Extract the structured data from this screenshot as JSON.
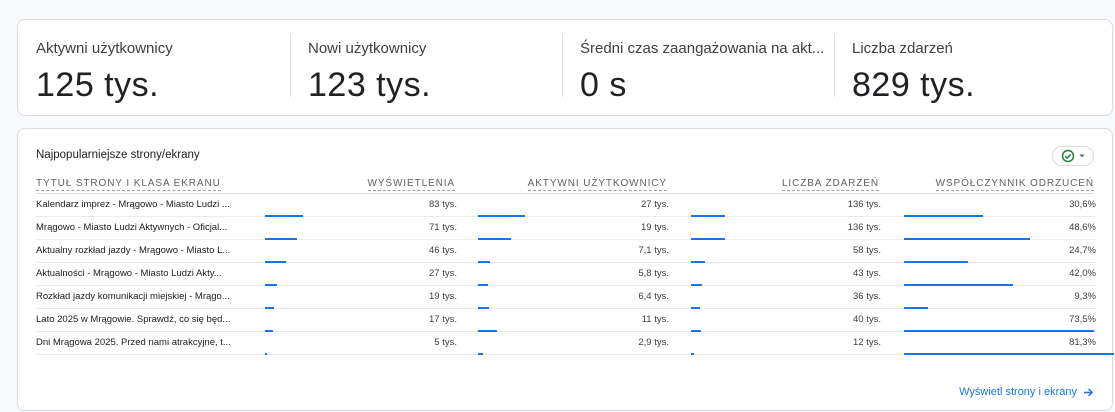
{
  "kpis": [
    {
      "label": "Aktywni użytkownicy",
      "value": "125 tys."
    },
    {
      "label": "Nowi użytkownicy",
      "value": "123 tys."
    },
    {
      "label": "Średni czas zaangażowania na akt...",
      "value": "0 s"
    },
    {
      "label": "Liczba zdarzeń",
      "value": "829 tys."
    }
  ],
  "table": {
    "title": "Najpopularniejsze strony/ekrany",
    "columns": [
      "TYTUŁ STRONY I KLASA EKRANU",
      "WYŚWIETLENIA",
      "AKTYWNI UŻYTKOWNICY",
      "LICZBA ZDARZEŃ",
      "WSPÓŁCZYNNIK ODRZUCEŃ"
    ],
    "rows": [
      {
        "title": "Kalendarz imprez - Mrągowo - Miasto Ludzi ...",
        "views": "83 tys.",
        "users": "27 tys.",
        "events": "136 tys.",
        "bounce": "30,6%",
        "views_frac": 1.0,
        "users_frac": 1.0,
        "events_frac": 1.0,
        "bounce_frac": 0.376
      },
      {
        "title": "Mrągowo - Miasto Ludzi Aktywnych - Oficjal...",
        "views": "71 tys.",
        "users": "19 tys.",
        "events": "136 tys.",
        "bounce": "48,6%",
        "views_frac": 0.855,
        "users_frac": 0.704,
        "events_frac": 1.0,
        "bounce_frac": 0.598
      },
      {
        "title": "Aktualny rozkład jazdy - Mrągowo - Miasto L...",
        "views": "46 tys.",
        "users": "7,1 tys.",
        "events": "58 tys.",
        "bounce": "24,7%",
        "views_frac": 0.554,
        "users_frac": 0.263,
        "events_frac": 0.426,
        "bounce_frac": 0.304
      },
      {
        "title": "Aktualności - Mrągowo - Miasto Ludzi Akty...",
        "views": "27 tys.",
        "users": "5,8 tys.",
        "events": "43 tys.",
        "bounce": "42,0%",
        "views_frac": 0.325,
        "users_frac": 0.215,
        "events_frac": 0.316,
        "bounce_frac": 0.517
      },
      {
        "title": "Rozkład jazdy komunikacji miejskiej - Mrągo...",
        "views": "19 tys.",
        "users": "6,4 tys.",
        "events": "36 tys.",
        "bounce": "9,3%",
        "views_frac": 0.229,
        "users_frac": 0.237,
        "events_frac": 0.265,
        "bounce_frac": 0.114
      },
      {
        "title": "Lato 2025 w Mrągowie. Sprawdź, co się będ...",
        "views": "17 tys.",
        "users": "11 tys.",
        "events": "40 tys.",
        "bounce": "73,5%",
        "views_frac": 0.205,
        "users_frac": 0.407,
        "events_frac": 0.294,
        "bounce_frac": 0.904
      },
      {
        "title": "Dni Mrągowa 2025. Przed nami atrakcyjne, t...",
        "views": "5 tys.",
        "users": "2,9 tys.",
        "events": "12 tys.",
        "bounce": "81,3%",
        "views_frac": 0.06,
        "users_frac": 0.107,
        "events_frac": 0.088,
        "bounce_frac": 1.0
      }
    ]
  },
  "link_label": "Wyświetl strony i ekrany",
  "colors": {
    "accent": "#1a73e8",
    "compare_icon": "#188038"
  },
  "icons": {
    "compare": "check-circle-icon",
    "dropdown": "caret-down-icon",
    "link": "arrow-right-icon"
  }
}
